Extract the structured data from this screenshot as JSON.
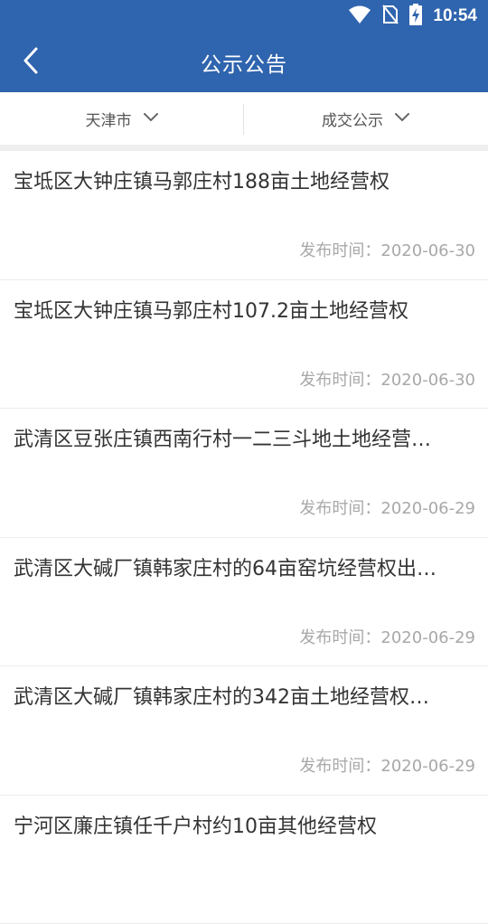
{
  "status": {
    "time": "10:54"
  },
  "appbar": {
    "title": "公示公告"
  },
  "filters": [
    {
      "label": "天津市"
    },
    {
      "label": "成交公示"
    }
  ],
  "date_label": "发布时间：",
  "items": [
    {
      "title": "宝坻区大钟庄镇马郭庄村188亩土地经营权",
      "date": "2020-06-30"
    },
    {
      "title": "宝坻区大钟庄镇马郭庄村107.2亩土地经营权",
      "date": "2020-06-30"
    },
    {
      "title": "武清区豆张庄镇西南行村一二三斗地土地经营…",
      "date": "2020-06-29"
    },
    {
      "title": "武清区大碱厂镇韩家庄村的64亩窑坑经营权出…",
      "date": "2020-06-29"
    },
    {
      "title": "武清区大碱厂镇韩家庄村的342亩土地经营权…",
      "date": "2020-06-29"
    },
    {
      "title": "宁河区廉庄镇任千户村约10亩其他经营权",
      "date": ""
    }
  ]
}
